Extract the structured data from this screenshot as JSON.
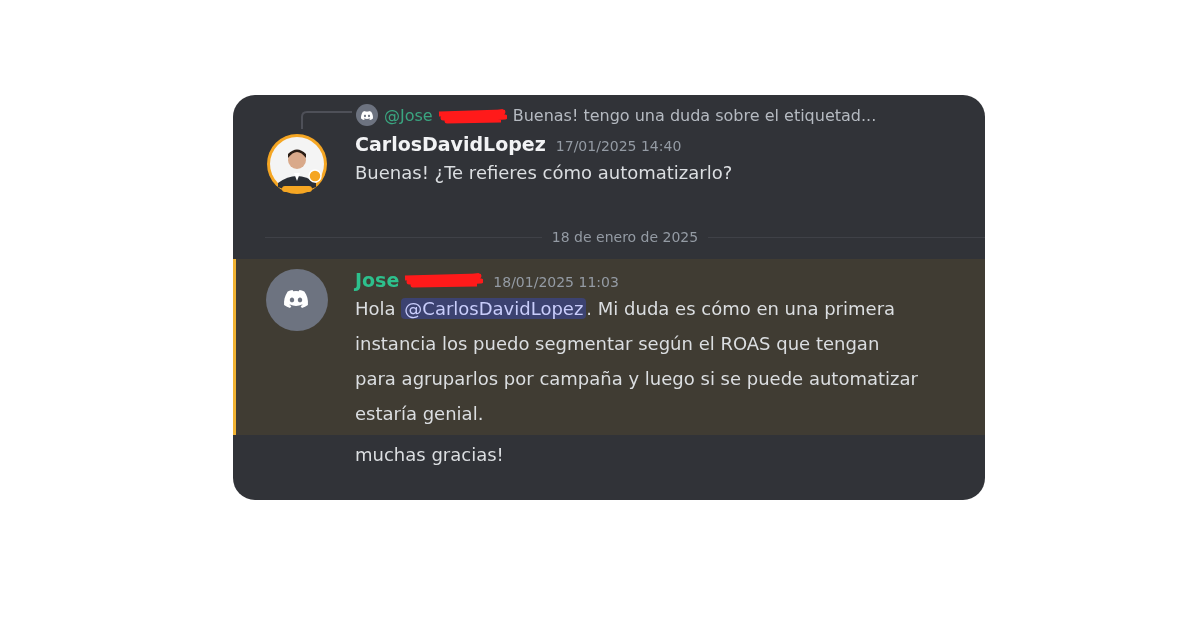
{
  "messages": [
    {
      "kind": "reply",
      "reply": {
        "mention": "@Jose",
        "text": "Buenas! tengo una duda sobre el etiquetad..."
      },
      "author": "CarlosDavidLopez",
      "timestamp": "17/01/2025 14:40",
      "avatar": {
        "kind": "photo"
      },
      "highlighted": false,
      "lines": [
        "Buenas! ¿Te refieres cómo automatizarlo?"
      ]
    },
    {
      "kind": "divider",
      "label": "18 de enero de 2025"
    },
    {
      "kind": "message",
      "author": "Jose",
      "author_redacted": true,
      "timestamp": "18/01/2025 11:03",
      "avatar": {
        "kind": "default"
      },
      "highlighted": true,
      "parts": [
        {
          "kind": "text",
          "text": "Hola "
        },
        {
          "kind": "mention",
          "text": "@CarlosDavidLopez"
        },
        {
          "kind": "text",
          "text": ". Mi duda es cómo en una primera instancia los puedo segmentar según el ROAS que tengan para agruparlos por campaña y luego si se puede automatizar estaría genial."
        }
      ]
    },
    {
      "kind": "continuation",
      "highlighted": false,
      "lines": [
        "muchas gracias!"
      ]
    }
  ]
}
